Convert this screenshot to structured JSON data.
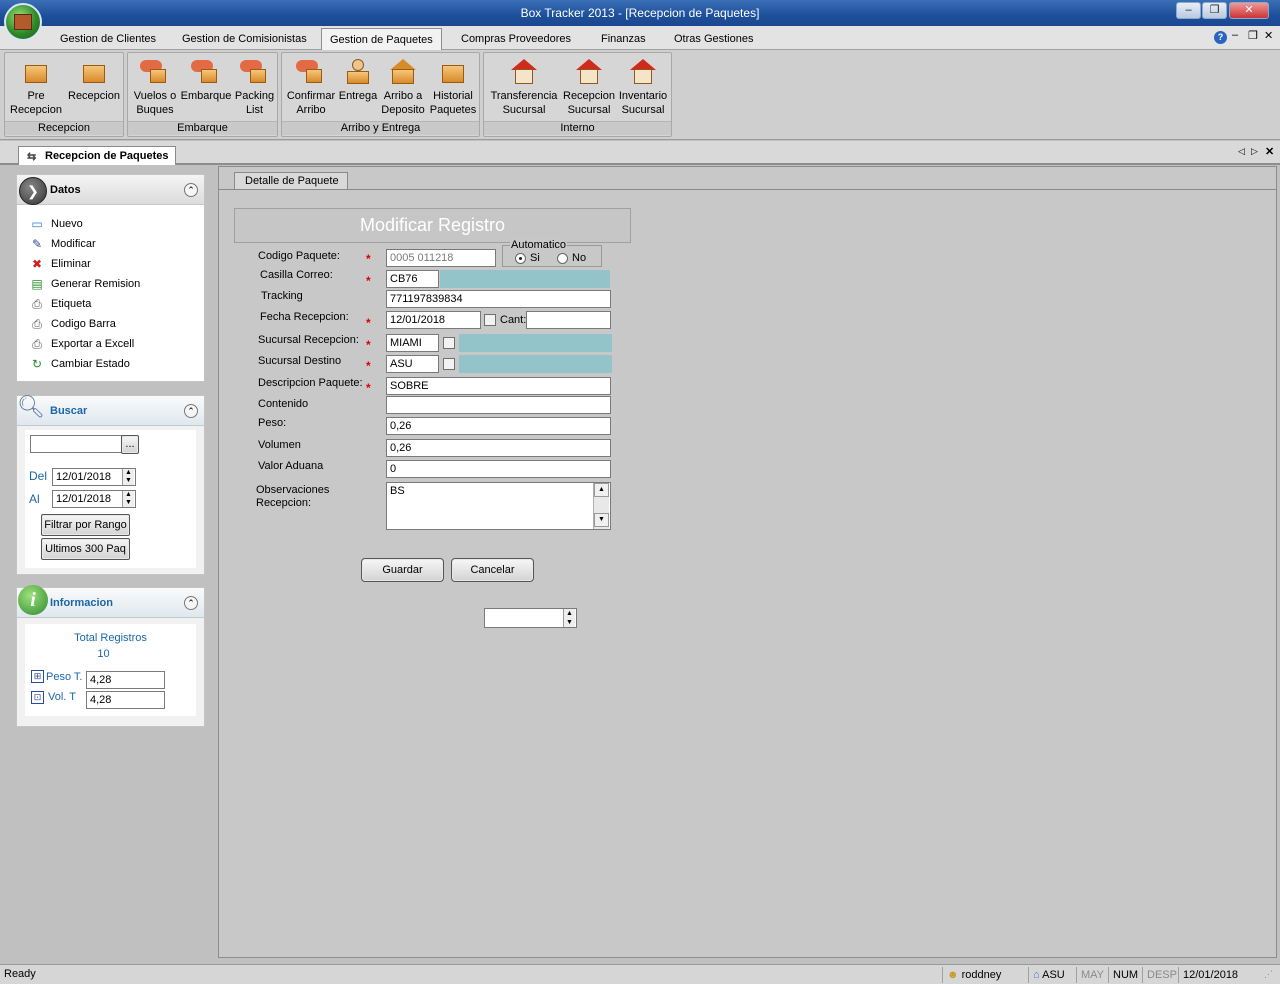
{
  "window": {
    "title": "Box Tracker 2013 - [Recepcion de Paquetes]"
  },
  "menu": {
    "tabs": [
      "Gestion de Clientes",
      "Gestion de Comisionistas",
      "Gestion de Paquetes",
      "Compras  Proveedores",
      "Finanzas",
      "Otras Gestiones"
    ],
    "active": "Gestion de Paquetes"
  },
  "ribbon": {
    "groups": [
      {
        "label": "Recepcion",
        "buttons": [
          {
            "l1": "Pre",
            "l2": "Recepcion",
            "icon": "package-search-icon"
          },
          {
            "l1": "Recepcion",
            "l2": "",
            "icon": "package-check-icon"
          }
        ]
      },
      {
        "label": "Embarque",
        "buttons": [
          {
            "l1": "Vuelos o",
            "l2": "Buques",
            "icon": "flight-icon"
          },
          {
            "l1": "Embarque",
            "l2": "",
            "icon": "shipment-icon"
          },
          {
            "l1": "Packing",
            "l2": "List",
            "icon": "packing-list-icon"
          }
        ]
      },
      {
        "label": "Arribo y Entrega",
        "buttons": [
          {
            "l1": "Confirmar",
            "l2": "Arribo",
            "icon": "confirm-arrival-icon"
          },
          {
            "l1": "Entrega",
            "l2": "",
            "icon": "delivery-icon"
          },
          {
            "l1": "Arribo a",
            "l2": "Deposito",
            "icon": "warehouse-arrival-icon"
          },
          {
            "l1": "Historial",
            "l2": "Paquetes",
            "icon": "history-icon"
          }
        ]
      },
      {
        "label": "Interno",
        "buttons": [
          {
            "l1": "Transferencia",
            "l2": "Sucursal",
            "icon": "transfer-icon"
          },
          {
            "l1": "Recepcion",
            "l2": "Sucursal",
            "icon": "branch-reception-icon"
          },
          {
            "l1": "Inventario",
            "l2": "Sucursal",
            "icon": "inventory-icon"
          }
        ]
      }
    ]
  },
  "doc_tab": "Recepcion de Paquetes",
  "datos": {
    "title": "Datos",
    "items": [
      "Nuevo",
      "Modificar",
      "Eliminar",
      "Generar Remision",
      "Etiqueta",
      "Codigo Barra",
      "Exportar a Excell",
      "Cambiar Estado"
    ]
  },
  "buscar": {
    "title": "Buscar",
    "search_value": "",
    "browse_label": "...",
    "del_label": "Del",
    "del_value": "12/01/2018",
    "al_label": "Al",
    "al_value": "12/01/2018",
    "filter_button": "Filtrar por Rango",
    "last_button": "Ultimos 300 Paq"
  },
  "informacion": {
    "title": "Informacion",
    "total_label": "Total Registros",
    "total_value": "10",
    "peso_label": "Peso T.",
    "peso_value": "4,28",
    "vol_label": "Vol. T",
    "vol_value": "4,28"
  },
  "form": {
    "subtab": "Detalle de Paquete",
    "header": "Modificar Registro",
    "labels": {
      "codigo": "Codigo Paquete:",
      "casilla": "Casilla Correo:",
      "tracking": "Tracking",
      "fecha": "Fecha Recepcion:",
      "cant": "Cant:",
      "suc_recepcion": "Sucursal Recepcion:",
      "suc_destino": "Sucursal Destino",
      "descripcion": "Descripcion Paquete:",
      "contenido": "Contenido",
      "peso": "Peso:",
      "volumen": "Volumen",
      "valor_aduana": "Valor Aduana",
      "observaciones_1": "Observaciones",
      "observaciones_2": "Recepcion:"
    },
    "automatico": {
      "label": "Automatico",
      "si": "Si",
      "no": "No",
      "selected": "Si"
    },
    "values": {
      "codigo": "0005 011218",
      "casilla": "CB76",
      "tracking": "771197839834",
      "fecha": "12/01/2018",
      "cant": "",
      "suc_recepcion": "MIAMI",
      "suc_destino": "ASU",
      "descripcion": "SOBRE",
      "contenido": "",
      "peso": "0,26",
      "volumen": "0,26",
      "valor_aduana": "0",
      "observaciones": "BS"
    },
    "guardar": "Guardar",
    "cancelar": "Cancelar",
    "combo_value": ""
  },
  "status": {
    "ready": "Ready",
    "user": "roddney",
    "branch": "ASU",
    "may": "MAY",
    "num": "NUM",
    "desp": "DESP",
    "date": "12/01/2018"
  },
  "colors": {
    "accent": "#1d4f9a",
    "teal_field": "#93c4ca",
    "required": "#dd0000",
    "panel_title": "#1a66a8"
  }
}
